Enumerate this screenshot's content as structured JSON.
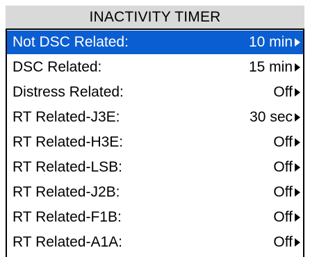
{
  "title": "INACTIVITY TIMER",
  "colors": {
    "selected_bg": "#0b5ed1",
    "title_bg": "#d9d9d9"
  },
  "items": [
    {
      "label": "Not DSC Related:",
      "value": "10 min",
      "selected": true
    },
    {
      "label": "DSC Related:",
      "value": "15 min",
      "selected": false
    },
    {
      "label": "Distress Related:",
      "value": "Off",
      "selected": false
    },
    {
      "label": "RT Related-J3E:",
      "value": "30 sec",
      "selected": false
    },
    {
      "label": "RT Related-H3E:",
      "value": "Off",
      "selected": false
    },
    {
      "label": "RT Related-LSB:",
      "value": "Off",
      "selected": false
    },
    {
      "label": "RT Related-J2B:",
      "value": "Off",
      "selected": false
    },
    {
      "label": "RT Related-F1B:",
      "value": "Off",
      "selected": false
    },
    {
      "label": "RT Related-A1A:",
      "value": "Off",
      "selected": false
    }
  ]
}
